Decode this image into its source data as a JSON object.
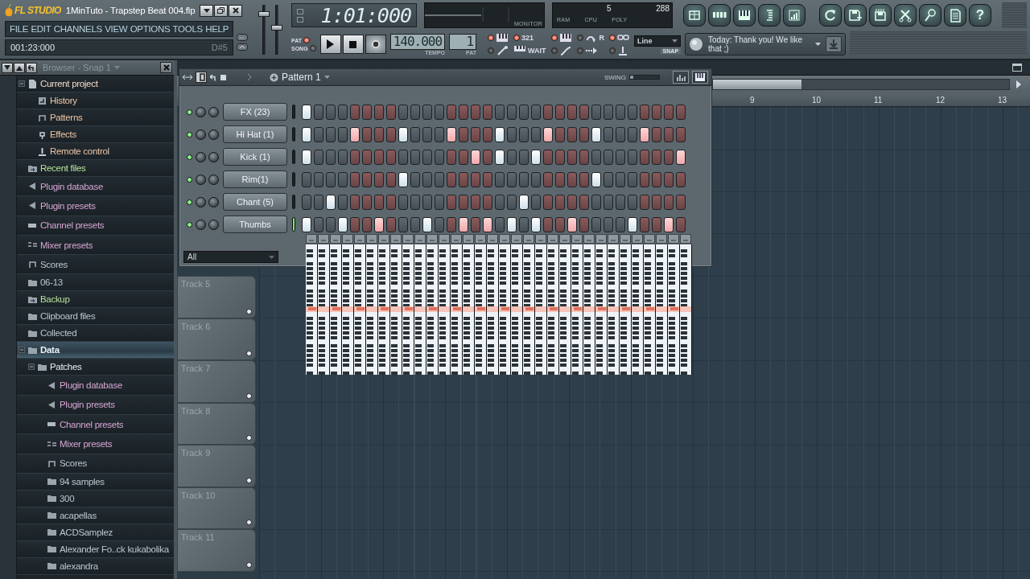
{
  "window": {
    "logo": "FL STUDIO",
    "title": "1MinTuto - Trapstep Beat 004.flp"
  },
  "menu": [
    "FILE",
    "EDIT",
    "CHANNELS",
    "VIEW",
    "OPTIONS",
    "TOOLS",
    "HELP"
  ],
  "hint_bar": {
    "position": "001:23:000",
    "note": "D#5"
  },
  "master": {
    "volume": {
      "level": 0.85
    },
    "pitch": {
      "level": 0.55
    }
  },
  "song_position": "1:01:000",
  "monitor": {
    "label": "MONITOR"
  },
  "performance": {
    "left_value": "5",
    "right_value": "288",
    "labels": [
      "RAM",
      "CPU",
      "POLY"
    ]
  },
  "tools": [
    {
      "kind": "playlist"
    },
    {
      "kind": "steps"
    },
    {
      "kind": "piano"
    },
    {
      "kind": "browser"
    },
    {
      "kind": "mixer"
    }
  ],
  "tools_2": [
    {
      "kind": "refresh"
    },
    {
      "kind": "save_new"
    },
    {
      "kind": "save"
    },
    {
      "kind": "cut"
    },
    {
      "kind": "mic"
    },
    {
      "kind": "doc"
    },
    {
      "kind": "help",
      "label": "?"
    }
  ],
  "transport": {
    "modes": [
      {
        "label": "PAT",
        "selected": true
      },
      {
        "label": "SONG",
        "selected": false
      }
    ],
    "tempo": "140.000",
    "tempo_label": "TEMPO",
    "pattern": "1",
    "pattern_label": "PAT"
  },
  "toggles": [
    {
      "kind": "keys",
      "on": true
    },
    {
      "kind": "wand",
      "on": false
    },
    {
      "kind": "countdown",
      "on": true,
      "label": "321"
    },
    {
      "kind": "wait",
      "label": "WAIT"
    },
    {
      "kind": "keys",
      "on": true
    },
    {
      "kind": "curve",
      "on": false
    },
    {
      "kind": "loop",
      "on": false,
      "label": "R"
    },
    {
      "kind": "arrow",
      "on": false
    },
    {
      "kind": "link",
      "on": true
    },
    {
      "kind": "pin",
      "on": false
    }
  ],
  "snap": {
    "value": "Line",
    "label": "SNAP"
  },
  "hint": {
    "text": "Today: Thank you! We like that ;)"
  },
  "browser": {
    "title": "Browser - Snap 1",
    "items": [
      {
        "label": "Current project",
        "kind": "project",
        "color": "#f2dccb",
        "selected": false,
        "expanded": true,
        "children": [
          {
            "label": "History",
            "kind": "history",
            "color": "#eec6a6",
            "selected": false
          },
          {
            "label": "Patterns",
            "kind": "pattern",
            "color": "#eec6a6",
            "selected": false
          },
          {
            "label": "Effects",
            "kind": "effect",
            "color": "#eec6a6",
            "selected": false
          },
          {
            "label": "Remote control",
            "kind": "remote",
            "color": "#eec6a6",
            "selected": false
          }
        ]
      },
      {
        "label": "Recent files",
        "kind": "recent",
        "color": "#b6e29e",
        "selected": false
      },
      {
        "label": "Plugin database",
        "kind": "plugin",
        "color": "#d6a6d4",
        "selected": false
      },
      {
        "label": "Plugin presets",
        "kind": "plugin",
        "color": "#d6a6d4",
        "selected": false
      },
      {
        "label": "Channel presets",
        "kind": "channel",
        "color": "#d6a6d4",
        "selected": false
      },
      {
        "label": "Mixer presets",
        "kind": "mixer",
        "color": "#d6a6d4",
        "selected": false
      },
      {
        "label": "Scores",
        "kind": "score",
        "color": "#bcc6d0",
        "selected": false
      },
      {
        "label": "06-13",
        "kind": "folder",
        "color": "#bcc6d0",
        "selected": false
      },
      {
        "label": "Backup",
        "kind": "recent",
        "color": "#b6e29e",
        "selected": false
      },
      {
        "label": "Clipboard files",
        "kind": "folder",
        "color": "#bcc6d0",
        "selected": false
      },
      {
        "label": "Collected",
        "kind": "folder",
        "color": "#bcc6d0",
        "selected": false
      },
      {
        "label": "Data",
        "kind": "folder",
        "color": "#e8f0f6",
        "selected": true,
        "expanded": true,
        "children": [
          {
            "label": "Patches",
            "kind": "folder",
            "color": "#e8f0f6",
            "selected": false,
            "expanded": true,
            "children": [
              {
                "label": "Plugin database",
                "kind": "plugin",
                "color": "#d6a6d4",
                "selected": false
              },
              {
                "label": "Plugin presets",
                "kind": "plugin",
                "color": "#d6a6d4",
                "selected": false
              },
              {
                "label": "Channel presets",
                "kind": "channel",
                "color": "#d6a6d4",
                "selected": false
              },
              {
                "label": "Mixer presets",
                "kind": "mixer",
                "color": "#d6a6d4",
                "selected": false
              },
              {
                "label": "Scores",
                "kind": "score",
                "color": "#bcc6d0",
                "selected": false
              },
              {
                "label": "94 samples",
                "kind": "folder",
                "color": "#bcc6d0",
                "selected": false
              },
              {
                "label": "300",
                "kind": "folder",
                "color": "#bcc6d0",
                "selected": false
              },
              {
                "label": "acapellas",
                "kind": "folder",
                "color": "#bcc6d0",
                "selected": false
              },
              {
                "label": "ACDSamplez",
                "kind": "folder",
                "color": "#bcc6d0",
                "selected": false
              },
              {
                "label": "Alexander Fo..ck kukabolika",
                "kind": "folder",
                "color": "#bcc6d0",
                "selected": false
              },
              {
                "label": "alexandra",
                "kind": "folder",
                "color": "#bcc6d0",
                "selected": false
              }
            ]
          }
        ]
      }
    ]
  },
  "playlist": {
    "bars": [
      "9",
      "10",
      "11",
      "12",
      "13"
    ],
    "tracks": [
      "Track 5",
      "Track 6",
      "Track 7",
      "Track 8",
      "Track 9",
      "Track 10",
      "Track 11"
    ]
  },
  "step_sequencer": {
    "pattern": "Pattern 1",
    "swing_label": "SWING",
    "swing": {
      "level": 0.1
    },
    "filter": "All",
    "channels": [
      {
        "name": "FX (23)",
        "selected": false,
        "steps": [
          true,
          false,
          false,
          false,
          false,
          false,
          false,
          false,
          false,
          false,
          false,
          false,
          false,
          false,
          false,
          false,
          false,
          false,
          false,
          false,
          false,
          false,
          false,
          false,
          false,
          false,
          false,
          false,
          false,
          false,
          false,
          false
        ]
      },
      {
        "name": "Hi Hat (1)",
        "selected": false,
        "steps": [
          true,
          false,
          false,
          false,
          true,
          false,
          false,
          false,
          true,
          false,
          false,
          false,
          true,
          false,
          false,
          false,
          true,
          false,
          false,
          false,
          true,
          false,
          false,
          false,
          true,
          false,
          false,
          false,
          true,
          false,
          false,
          false
        ]
      },
      {
        "name": "Kick (1)",
        "selected": false,
        "steps": [
          true,
          false,
          false,
          false,
          false,
          false,
          false,
          false,
          false,
          false,
          false,
          false,
          false,
          false,
          true,
          false,
          true,
          false,
          false,
          true,
          false,
          false,
          false,
          false,
          false,
          false,
          false,
          false,
          false,
          false,
          false,
          true
        ]
      },
      {
        "name": "Rim(1)",
        "selected": false,
        "steps": [
          false,
          false,
          false,
          false,
          false,
          false,
          false,
          false,
          true,
          false,
          false,
          false,
          false,
          false,
          false,
          false,
          false,
          false,
          false,
          false,
          false,
          false,
          false,
          false,
          true,
          false,
          false,
          false,
          false,
          false,
          false,
          false
        ]
      },
      {
        "name": "Chant (5)",
        "selected": false,
        "steps": [
          false,
          false,
          true,
          false,
          false,
          false,
          false,
          false,
          false,
          false,
          false,
          false,
          false,
          false,
          false,
          false,
          false,
          false,
          true,
          false,
          false,
          false,
          false,
          false,
          false,
          false,
          false,
          false,
          false,
          false,
          false,
          false
        ]
      },
      {
        "name": "Thumbs",
        "selected": true,
        "steps": [
          true,
          false,
          false,
          true,
          false,
          false,
          true,
          false,
          false,
          false,
          true,
          false,
          false,
          true,
          false,
          true,
          false,
          true,
          false,
          true,
          false,
          false,
          true,
          false,
          false,
          false,
          false,
          true,
          false,
          false,
          true,
          false
        ]
      }
    ]
  }
}
